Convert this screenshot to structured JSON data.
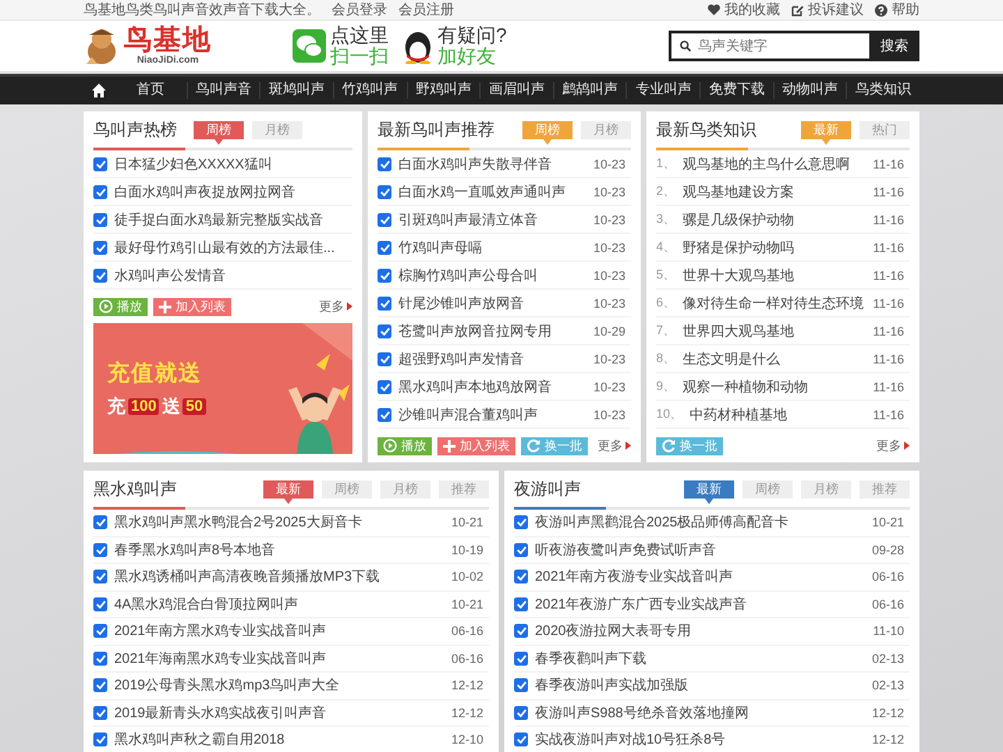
{
  "top_bar": {
    "intro": "鸟基地鸟类鸟叫声音效声音下载大全。",
    "links": [
      {
        "label": "会员登录"
      },
      {
        "label": "会员注册"
      }
    ],
    "right_links": [
      {
        "kind": "heart",
        "label": "我的收藏"
      },
      {
        "kind": "edit",
        "label": "投诉建议"
      },
      {
        "kind": "help",
        "label": "帮助"
      }
    ]
  },
  "header": {
    "logo_name": "鸟基地",
    "logo_domain": "NiaoJiDi.com",
    "promos": [
      {
        "kind": "wechat",
        "line1": "点这里",
        "line2": "扫一扫"
      },
      {
        "kind": "qq",
        "line1": "有疑问?",
        "line2": "加好友"
      }
    ],
    "search": {
      "placeholder": "鸟声关键字",
      "button": "搜索"
    }
  },
  "nav": {
    "items": [
      "首页",
      "鸟叫声音",
      "斑鸠叫声",
      "竹鸡叫声",
      "野鸡叫声",
      "画眉叫声",
      "鹧鸪叫声",
      "专业叫声",
      "免费下载",
      "动物叫声",
      "鸟类知识"
    ]
  },
  "panels": [
    {
      "title": "鸟叫声热榜",
      "color": "#e05a5a",
      "kind": "check",
      "tabs": [
        {
          "label": "周榜",
          "selected": true
        },
        {
          "label": "月榜",
          "selected": false
        }
      ],
      "items": [
        {
          "checked": true,
          "text": "日本猛少妇色XXXXX猛叫"
        },
        {
          "checked": true,
          "text": "白面水鸡叫声夜捉放网拉网音"
        },
        {
          "checked": true,
          "text": "徒手捉白面水鸡最新完整版实战音"
        },
        {
          "checked": true,
          "text": "最好母竹鸡引山最有效的方法最佳..."
        },
        {
          "checked": true,
          "text": "水鸡叫声公发情音"
        }
      ],
      "actions": [
        {
          "kind": "play",
          "label": "播放"
        },
        {
          "kind": "add",
          "label": "加入列表"
        }
      ],
      "more": "更多",
      "banner": {
        "headline": "充值就送",
        "offer": [
          {
            "kind": "text",
            "text": "充"
          },
          {
            "kind": "highlight",
            "text": "100"
          },
          {
            "kind": "text",
            "text": "送"
          },
          {
            "kind": "highlight",
            "text": "50"
          }
        ]
      }
    },
    {
      "title": "最新鸟叫声推荐",
      "color": "#f0a53c",
      "kind": "check",
      "tabs": [
        {
          "label": "周榜",
          "selected": true
        },
        {
          "label": "月榜",
          "selected": false
        }
      ],
      "items": [
        {
          "checked": true,
          "text": "白面水鸡叫声失散寻伴音",
          "date": "10-23"
        },
        {
          "checked": true,
          "text": "白面水鸡一直呱效声通叫声",
          "date": "10-23"
        },
        {
          "checked": true,
          "text": "引斑鸡叫声最清立体音",
          "date": "10-23"
        },
        {
          "checked": true,
          "text": "竹鸡叫声母嗝",
          "date": "10-23"
        },
        {
          "checked": true,
          "text": "棕胸竹鸡叫声公母合叫",
          "date": "10-23"
        },
        {
          "checked": true,
          "text": "针尾沙锥叫声放网音",
          "date": "10-23"
        },
        {
          "checked": true,
          "text": "苍鹭叫声放网音拉网专用",
          "date": "10-29"
        },
        {
          "checked": true,
          "text": "超强野鸡叫声发情音",
          "date": "10-23"
        },
        {
          "checked": true,
          "text": "黑水鸡叫声本地鸡放网音",
          "date": "10-23"
        },
        {
          "checked": true,
          "text": "沙锥叫声混合董鸡叫声",
          "date": "10-23"
        }
      ],
      "actions": [
        {
          "kind": "play",
          "label": "播放"
        },
        {
          "kind": "add",
          "label": "加入列表"
        },
        {
          "kind": "refresh",
          "label": "换一批"
        }
      ],
      "more": "更多"
    },
    {
      "title": "最新鸟类知识",
      "color": "#f0a53c",
      "kind": "numbered",
      "tabs": [
        {
          "label": "最新",
          "selected": true
        },
        {
          "label": "热门",
          "selected": false
        }
      ],
      "items": [
        {
          "num": "1、",
          "text": "观鸟基地的主鸟什么意思啊",
          "date": "11-16"
        },
        {
          "num": "2、",
          "text": "观鸟基地建设方案",
          "date": "11-16"
        },
        {
          "num": "3、",
          "text": "骡是几级保护动物",
          "date": "11-16"
        },
        {
          "num": "4、",
          "text": "野猪是保护动物吗",
          "date": "11-16"
        },
        {
          "num": "5、",
          "text": "世界十大观鸟基地",
          "date": "11-16"
        },
        {
          "num": "6、",
          "text": "像对待生命一样对待生态环境",
          "date": "11-16"
        },
        {
          "num": "7、",
          "text": "世界四大观鸟基地",
          "date": "11-16"
        },
        {
          "num": "8、",
          "text": "生态文明是什么",
          "date": "11-16"
        },
        {
          "num": "9、",
          "text": "观察一种植物和动物",
          "date": "11-16"
        },
        {
          "num": "10、",
          "text": "中药材种植基地",
          "date": "11-16"
        }
      ],
      "actions": [
        {
          "kind": "refresh",
          "label": "换一批"
        }
      ],
      "more": "更多"
    },
    {
      "title": "黑水鸡叫声",
      "color": "#e05a5a",
      "kind": "check",
      "tabs": [
        {
          "label": "最新",
          "selected": true
        },
        {
          "label": "周榜",
          "selected": false
        },
        {
          "label": "月榜",
          "selected": false
        },
        {
          "label": "推荐",
          "selected": false
        }
      ],
      "items": [
        {
          "checked": true,
          "text": "黑水鸡叫声黑水鸭混合2号2025大厨音卡",
          "date": "10-21"
        },
        {
          "checked": true,
          "text": "春季黑水鸡叫声8号本地音",
          "date": "10-19"
        },
        {
          "checked": true,
          "text": "黑水鸡诱桶叫声高清夜晚音频播放MP3下载",
          "date": "10-02"
        },
        {
          "checked": true,
          "text": "4A黑水鸡混合白骨顶拉网叫声",
          "date": "10-21"
        },
        {
          "checked": true,
          "text": "2021年南方黑水鸡专业实战音叫声",
          "date": "06-16"
        },
        {
          "checked": true,
          "text": "2021年海南黑水鸡专业实战音叫声",
          "date": "06-16"
        },
        {
          "checked": true,
          "text": "2019公母青头黑水鸡mp3鸟叫声大全",
          "date": "12-12"
        },
        {
          "checked": true,
          "text": "2019最新青头水鸡实战夜引叫声音",
          "date": "12-12"
        },
        {
          "checked": true,
          "text": "黑水鸡叫声秋之霸自用2018",
          "date": "12-10"
        }
      ]
    },
    {
      "title": "夜游叫声",
      "color": "#3a7cc2",
      "kind": "check",
      "tabs": [
        {
          "label": "最新",
          "selected": true
        },
        {
          "label": "周榜",
          "selected": false
        },
        {
          "label": "月榜",
          "selected": false
        },
        {
          "label": "推荐",
          "selected": false
        }
      ],
      "items": [
        {
          "checked": true,
          "text": "夜游叫声黑鹳混合2025极品师傅高配音卡",
          "date": "10-21"
        },
        {
          "checked": true,
          "text": "听夜游夜鹭叫声免费试听声音",
          "date": "09-28"
        },
        {
          "checked": true,
          "text": "2021年南方夜游专业实战音叫声",
          "date": "06-16"
        },
        {
          "checked": true,
          "text": "2021年夜游广东广西专业实战声音",
          "date": "06-16"
        },
        {
          "checked": true,
          "text": "2020夜游拉网大表哥专用",
          "date": "11-10"
        },
        {
          "checked": true,
          "text": "春季夜鹳叫声下载",
          "date": "02-13"
        },
        {
          "checked": true,
          "text": "春季夜游叫声实战加强版",
          "date": "02-13"
        },
        {
          "checked": true,
          "text": "夜游叫声S988号绝杀音效落地撞网",
          "date": "12-12"
        },
        {
          "checked": true,
          "text": "实战夜游叫声对战10号狂杀8号",
          "date": "12-12"
        }
      ]
    }
  ]
}
